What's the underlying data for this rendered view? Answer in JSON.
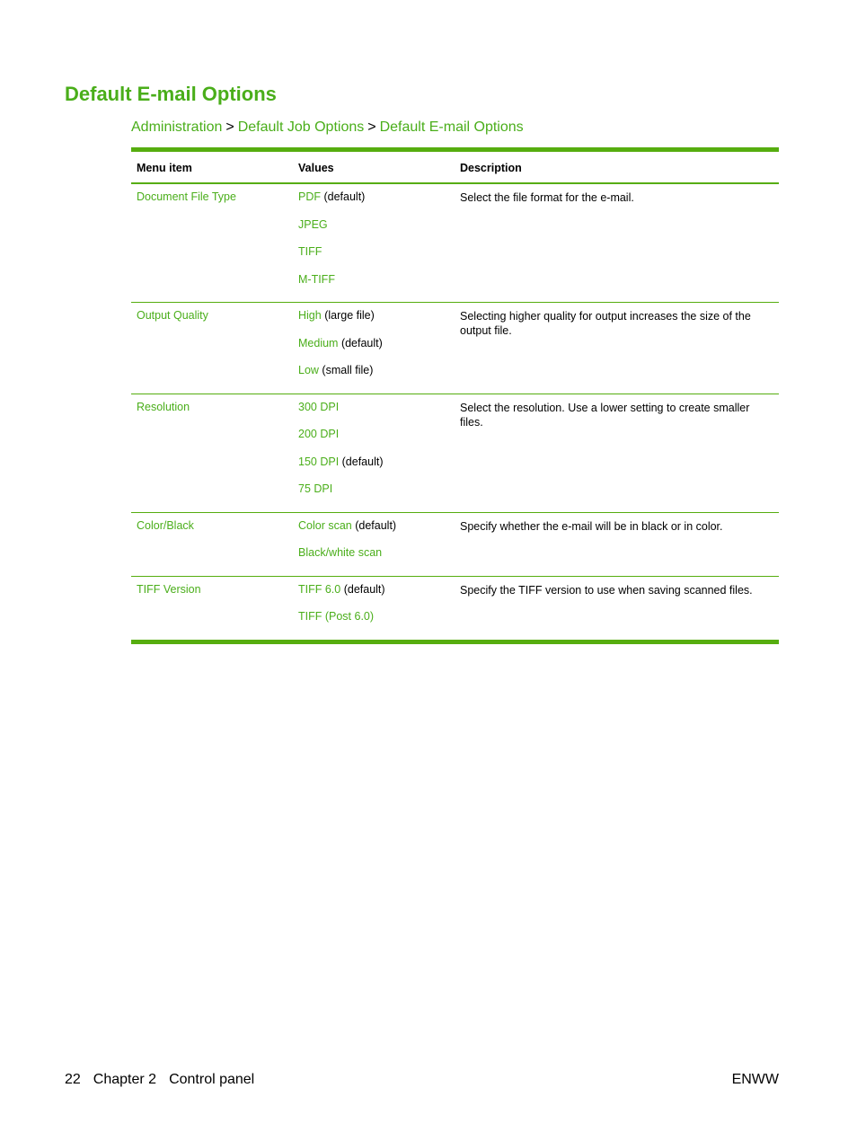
{
  "page": {
    "title": "Default E-mail Options",
    "breadcrumb": {
      "items": [
        "Administration",
        "Default Job Options",
        "Default E-mail Options"
      ],
      "separator": ">"
    },
    "accent_color": "#4aae1a"
  },
  "table": {
    "headers": [
      "Menu item",
      "Values",
      "Description"
    ],
    "rows": [
      {
        "menu_item": "Document File Type",
        "values": [
          {
            "option": "PDF",
            "note": " (default)"
          },
          {
            "option": "JPEG",
            "note": ""
          },
          {
            "option": "TIFF",
            "note": ""
          },
          {
            "option": "M-TIFF",
            "note": ""
          }
        ],
        "description": "Select the file format for the e-mail."
      },
      {
        "menu_item": "Output Quality",
        "values": [
          {
            "option": "High",
            "note": " (large file)"
          },
          {
            "option": "Medium",
            "note": " (default)"
          },
          {
            "option": "Low",
            "note": " (small file)"
          }
        ],
        "description": "Selecting higher quality for output increases the size of the output file."
      },
      {
        "menu_item": "Resolution",
        "values": [
          {
            "option": "300 DPI",
            "note": ""
          },
          {
            "option": "200 DPI",
            "note": ""
          },
          {
            "option": "150 DPI",
            "note": " (default)"
          },
          {
            "option": "75 DPI",
            "note": ""
          }
        ],
        "description": "Select the resolution. Use a lower setting to create smaller files."
      },
      {
        "menu_item": "Color/Black",
        "values": [
          {
            "option": "Color scan",
            "note": " (default)"
          },
          {
            "option": "Black/white scan",
            "note": ""
          }
        ],
        "description": "Specify whether the e-mail will be in black or in color."
      },
      {
        "menu_item": "TIFF Version",
        "values": [
          {
            "option": "TIFF 6.0",
            "note": " (default)"
          },
          {
            "option": "TIFF (Post 6.0)",
            "note": ""
          }
        ],
        "description": "Specify the TIFF version to use when saving scanned files."
      }
    ]
  },
  "footer": {
    "page_number": "22",
    "chapter": "Chapter 2",
    "section": "Control panel",
    "locale_code": "ENWW"
  }
}
